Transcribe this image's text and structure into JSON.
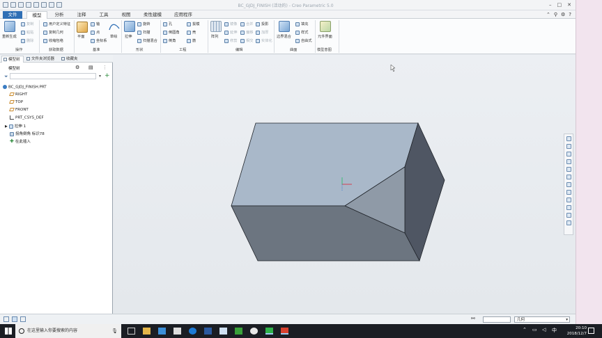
{
  "window": {
    "title": "BC_GJDJ_FINISH (活动的) - Creo Parametric 5.0"
  },
  "tabs": [
    "文件",
    "模型",
    "分析",
    "注释",
    "工具",
    "视图",
    "柔性建模",
    "应用程序"
  ],
  "ribbon": {
    "regenerate": "重新生成",
    "copy": "复制",
    "paste": "粘贴",
    "delete": "删除",
    "udf": "用户定义特征",
    "copy_geom": "复制几何",
    "shrinkwrap": "收缩包络",
    "plane": "平面",
    "axis": "轴",
    "point": "点",
    "csys": "坐标系",
    "sketch": "草绘",
    "extrude": "拉伸",
    "revolve": "旋转",
    "sweep": "扫描",
    "swept_blend": "扫描混合",
    "hole": "孔",
    "round": "倒圆角",
    "chamfer": "倒角",
    "draft": "拔模",
    "shell": "壳",
    "rib": "筋",
    "pattern": "阵列",
    "mirror": "镜像",
    "extend": "延伸",
    "trim": "修剪",
    "merge": "合并",
    "offset": "偏移",
    "intersect": "相交",
    "project": "投影",
    "thicken": "加厚",
    "solidify": "实体化",
    "boundary_blend": "边界混合",
    "fill": "填充",
    "style": "样式",
    "freestyle": "自由式",
    "component_interface": "元件界面",
    "groups": {
      "operations": "操作",
      "get_data": "获取数据",
      "datum": "基准",
      "shapes": "形状",
      "engineering": "工程",
      "editing": "编辑",
      "surfaces": "曲面",
      "model_intent": "模型意图"
    }
  },
  "left_panel": {
    "tabs": [
      "模型树",
      "文件夹浏览器",
      "收藏夹"
    ],
    "tree_header": "模型树",
    "items": [
      {
        "label": "BC_GJDJ_FINISH.PRT"
      },
      {
        "label": "RIGHT"
      },
      {
        "label": "TOP"
      },
      {
        "label": "FRONT"
      },
      {
        "label": "PRT_CSYS_DEF"
      },
      {
        "label": "拉伸 1"
      },
      {
        "label": "拐角倒角 标识78"
      },
      {
        "label": "在此插入"
      }
    ]
  },
  "status": {
    "filter": "几何"
  },
  "taskbar": {
    "search_placeholder": "在这里输入你要搜索的内容",
    "time": "20:10",
    "date": "2018/12/7"
  }
}
